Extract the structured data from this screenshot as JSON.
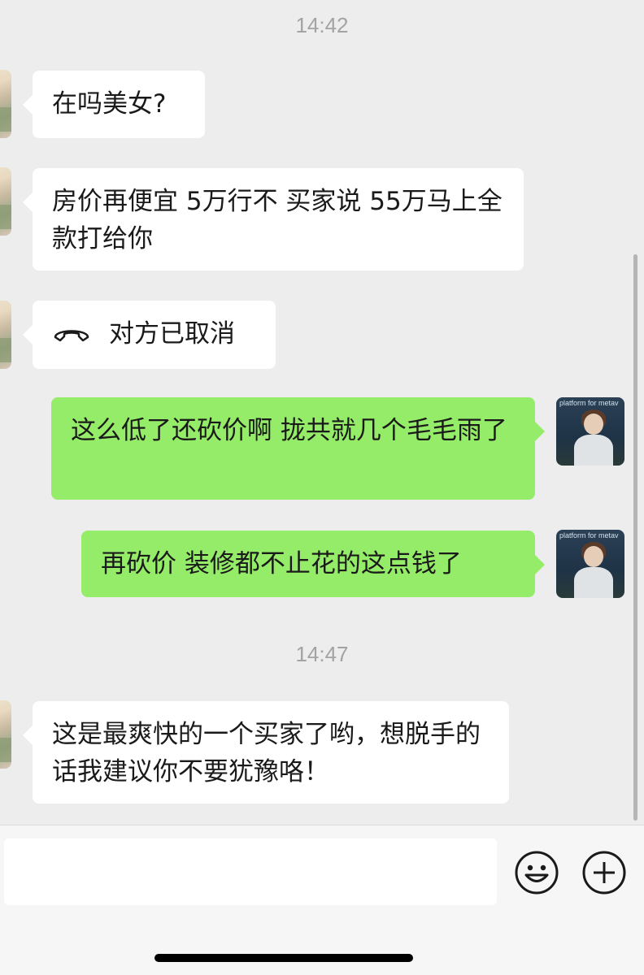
{
  "timestamps": [
    "14:42",
    "14:47"
  ],
  "messages": [
    {
      "side": "left",
      "text": "在吗美女?"
    },
    {
      "side": "left",
      "text": "房价再便宜 5万行不 买家说 55万马上全款打给你"
    },
    {
      "side": "left",
      "type": "call",
      "icon": "phone-hangup-icon",
      "text": "对方已取消"
    },
    {
      "side": "right",
      "text": "这么低了还砍价啊 拢共就几个毛毛雨了"
    },
    {
      "side": "right",
      "text": "再砍价 装修都不止花的这点钱了"
    },
    {
      "side": "left",
      "text": "这是最爽快的一个买家了哟，想脱手的话我建议你不要犹豫咯！"
    }
  ],
  "avatar_right": {
    "sign_text": "platform for metav"
  },
  "input": {
    "value": ""
  },
  "toolbar": {
    "emoji_icon": "emoji-icon",
    "add_icon": "plus-circle-icon"
  },
  "colors": {
    "background": "#ededed",
    "left_bubble": "#ffffff",
    "right_bubble": "#95ec69",
    "time_text": "#a3a3a3"
  }
}
